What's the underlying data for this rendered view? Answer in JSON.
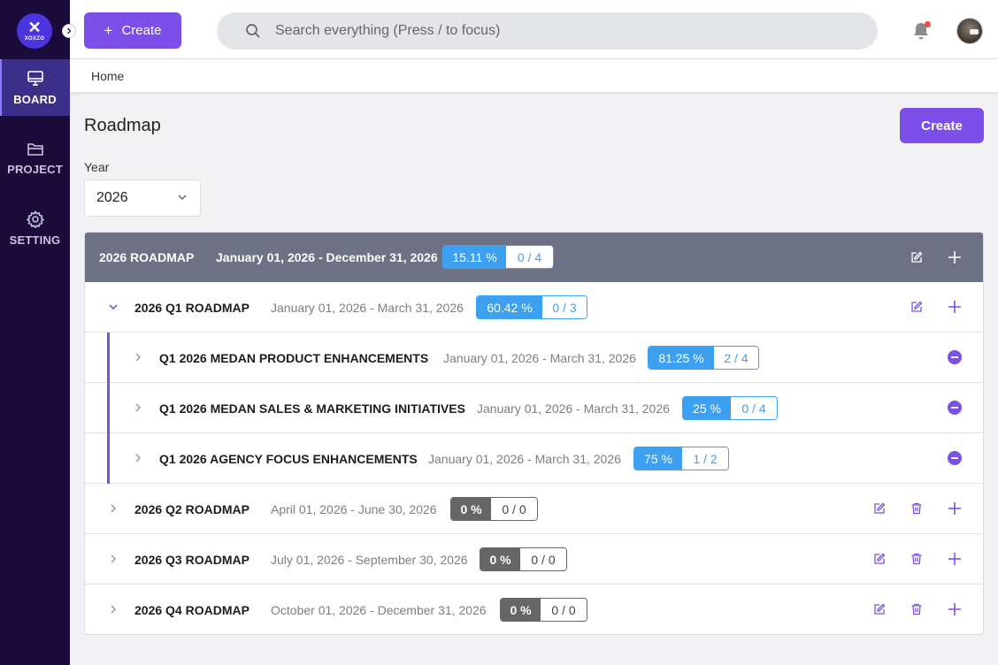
{
  "brand": {
    "logo_mark": "✕",
    "logo_text": "XOXZO"
  },
  "sidebar": {
    "items": [
      {
        "label": "BOARD",
        "icon": "monitor-icon",
        "active": true
      },
      {
        "label": "PROJECT",
        "icon": "folder-icon",
        "active": false
      },
      {
        "label": "SETTING",
        "icon": "gear-icon",
        "active": false
      }
    ]
  },
  "topbar": {
    "create_label": "Create",
    "search_placeholder": "Search everything (Press / to focus)",
    "notification_icon": "bell-icon",
    "accent_color": "#7b4fe8"
  },
  "breadcrumb": {
    "home": "Home"
  },
  "main": {
    "title": "Roadmap",
    "create_label": "Create",
    "year_label": "Year",
    "year_value": "2026"
  },
  "roadmap": {
    "header": {
      "name": "2026 ROADMAP",
      "date": "January 01, 2026 - December 31, 2026",
      "pct": "15.11 %",
      "count": "0 / 4"
    },
    "q1": {
      "name": "2026 Q1 ROADMAP",
      "date": "January 01, 2026 - March 31, 2026",
      "pct": "60.42 %",
      "count": "0 / 3"
    },
    "subs": [
      {
        "name": "Q1 2026 MEDAN PRODUCT ENHANCEMENTS",
        "date": "January 01, 2026 - March 31, 2026",
        "pct": "81.25 %",
        "count": "2 / 4"
      },
      {
        "name": "Q1 2026 MEDAN SALES & MARKETING INITIATIVES",
        "date": "January 01, 2026 - March 31, 2026",
        "pct": "25 %",
        "count": "0 / 4"
      },
      {
        "name": "Q1 2026 AGENCY FOCUS ENHANCEMENTS",
        "date": "January 01, 2026 - March 31, 2026",
        "pct": "75 %",
        "count": "1 / 2"
      }
    ],
    "quarters": [
      {
        "name": "2026 Q2 ROADMAP",
        "date": "April 01, 2026 - June 30, 2026",
        "pct": "0 %",
        "count": "0 / 0"
      },
      {
        "name": "2026 Q3 ROADMAP",
        "date": "July 01, 2026 - September 30, 2026",
        "pct": "0 %",
        "count": "0 / 0"
      },
      {
        "name": "2026 Q4 ROADMAP",
        "date": "October 01, 2026 - December 31, 2026",
        "pct": "0 %",
        "count": "0 / 0"
      }
    ]
  }
}
